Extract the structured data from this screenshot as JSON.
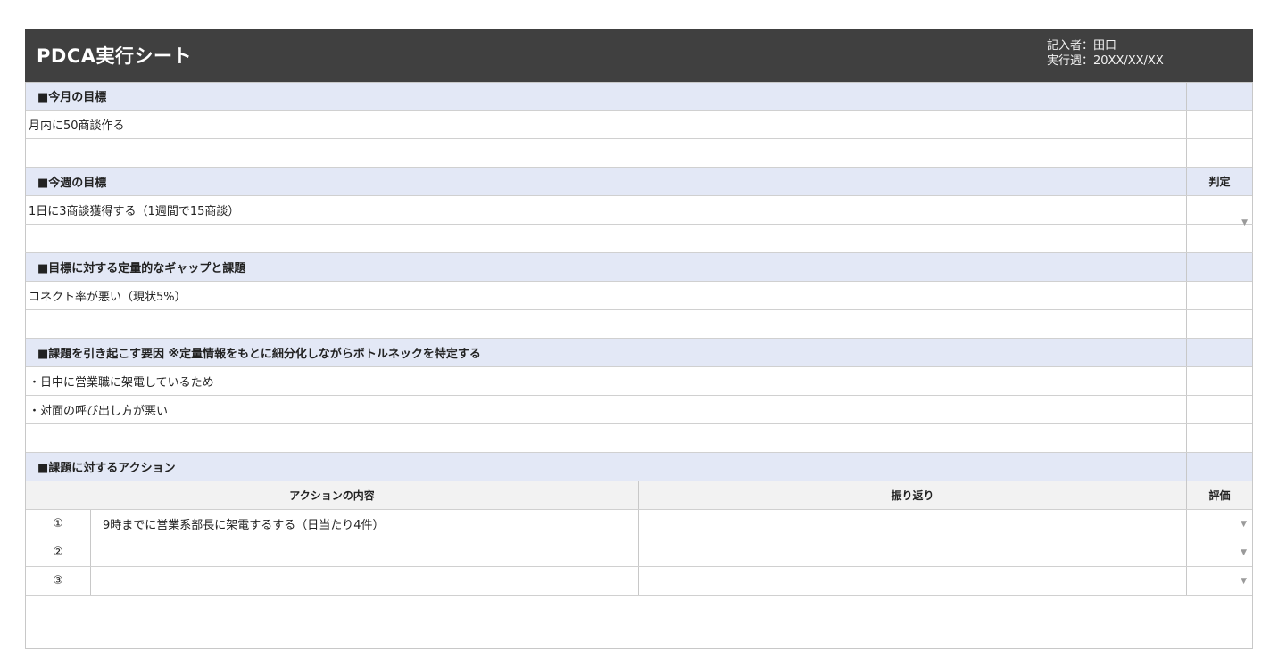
{
  "header": {
    "title": "PDCA実行シート",
    "recorder": "記入者：田口",
    "week": "実行週：20XX/XX/XX"
  },
  "sections": {
    "monthly_goal": {
      "heading": "■今月の目標",
      "lines": [
        "月内に50商談作る",
        ""
      ]
    },
    "weekly_goal": {
      "heading": "■今週の目標",
      "side_label": "判定",
      "lines": [
        "1日に3商談獲得する（1週間で15商談）",
        ""
      ]
    },
    "gap": {
      "heading": "■目標に対する定量的なギャップと課題",
      "lines": [
        "コネクト率が悪い（現状5%）",
        ""
      ]
    },
    "causes": {
      "heading": "■課題を引き起こす要因 ※定量情報をもとに細分化しながらボトルネックを特定する",
      "lines": [
        "・日中に営業職に架電しているため",
        "・対面の呼び出し方が悪い",
        ""
      ]
    },
    "actions": {
      "heading": "■課題に対するアクション",
      "col_action": "アクションの内容",
      "col_review": "振り返り",
      "col_eval": "評価",
      "rows": [
        {
          "num": "①",
          "action": "9時までに営業系部長に架電するする（日当たり4件）",
          "review": ""
        },
        {
          "num": "②",
          "action": "",
          "review": ""
        },
        {
          "num": "③",
          "action": "",
          "review": ""
        }
      ]
    }
  },
  "icons": {
    "dropdown": "dropdown-arrow-icon"
  },
  "colors": {
    "header_bg": "#404040",
    "section_bg": "#e3e8f6",
    "table_header_bg": "#f2f2f2"
  }
}
